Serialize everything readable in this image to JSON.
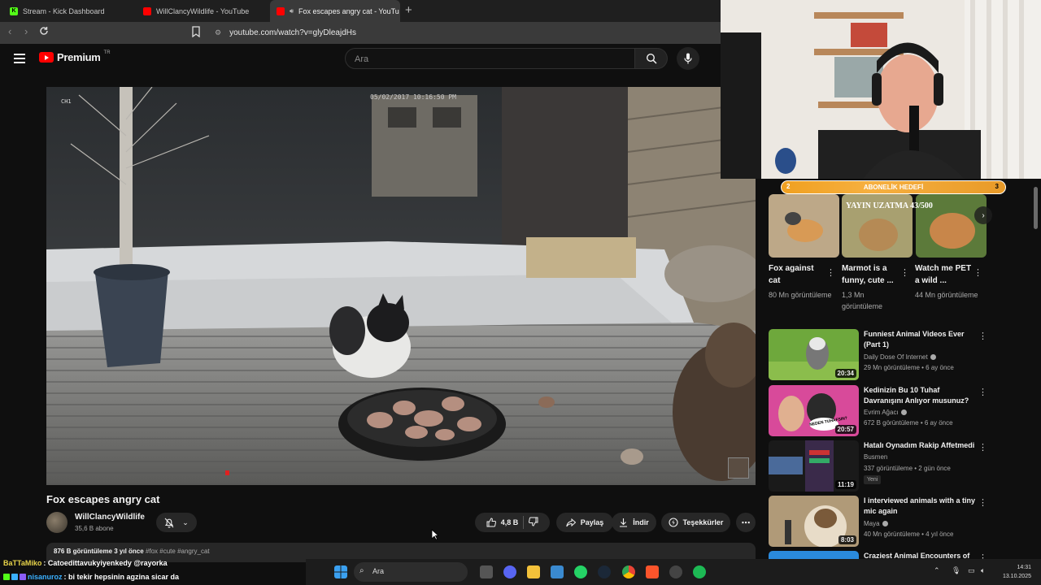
{
  "browser": {
    "tabs": [
      {
        "label": "Stream - Kick Dashboard",
        "fav_color": "#53fc18",
        "fav_letter": "K"
      },
      {
        "label": "WillClancyWildlife - YouTube",
        "fav_color": "#ff0000",
        "fav_letter": ""
      },
      {
        "label": "Fox escapes angry cat - YouTu",
        "fav_color": "#ff0000",
        "fav_letter": ""
      }
    ],
    "url": "youtube.com/watch?v=glyDleajdHs"
  },
  "header": {
    "logo_text": "Premium",
    "logo_region": "TR",
    "search_placeholder": "Ara"
  },
  "video": {
    "cam_timestamp": "05/02/2017 10:16:50 PM",
    "cam_id": "CH1",
    "title": "Fox escapes angry cat"
  },
  "channel": {
    "name": "WillClancyWildlife",
    "subs": "35,6 B abone"
  },
  "actions": {
    "likes": "4,8 B",
    "share": "Paylaş",
    "download": "İndir",
    "thanks": "Teşekkürler"
  },
  "description": {
    "stats": "876 B görüntüleme  3 yıl önce",
    "tags": "#fox #cute #angry_cat"
  },
  "subgoal": {
    "label": "ABONELİK HEDEFİ",
    "left": "2",
    "right": "3"
  },
  "shelf": {
    "ad_text": "YAYIN UZATMA 43/500",
    "items": [
      {
        "title": "Fox against cat",
        "views": "80 Mn görüntüleme"
      },
      {
        "title": "Marmot is a funny, cute ...",
        "views": "1,3 Mn görüntüleme"
      },
      {
        "title": "Watch me PET a  wild ...",
        "views": "44 Mn görüntüleme"
      }
    ]
  },
  "recommendations": [
    {
      "title": "Funniest Animal Videos Ever (Part 1)",
      "channel": "Daily Dose Of Internet",
      "meta": "29 Mn görüntüleme • 6 ay önce",
      "duration": "20:34",
      "badge": ""
    },
    {
      "title": "Kedinizin Bu 10 Tuhaf Davranışını Anlıyor musunuz?",
      "channel": "Evrim Ağacı",
      "meta": "672 B görüntüleme • 6 ay önce",
      "duration": "20:57",
      "badge": "",
      "thumb_text": "NEDEN TUHAFSIN?"
    },
    {
      "title": "Hatalı Oynadım Rakip Affetmedi",
      "channel": "Busmen",
      "meta": "337 görüntüleme • 2 gün önce",
      "duration": "11:19",
      "badge": "Yeni"
    },
    {
      "title": "I interviewed animals with a tiny mic again",
      "channel": "Maya",
      "meta": "40 Mn görüntüleme • 4 yıl önce",
      "duration": "8:03",
      "badge": ""
    },
    {
      "title": "Craziest Animal Encounters of",
      "channel": "",
      "meta": "",
      "duration": "",
      "badge": ""
    }
  ],
  "chat": [
    {
      "user": "BaTTaMiko",
      "message": ": Catoedittavukyiyenkedy @rayorka"
    },
    {
      "user": "nisanuroz",
      "message": ": bi tekir hepsinin agzina sicar da"
    }
  ],
  "taskbar": {
    "search_label": "Ara",
    "time": "14:31",
    "date": "13.10.2025"
  },
  "colors": {
    "background": "#0f0f0f",
    "youtube_red": "#ff0000",
    "subgoal_orange": "#f0a020"
  }
}
